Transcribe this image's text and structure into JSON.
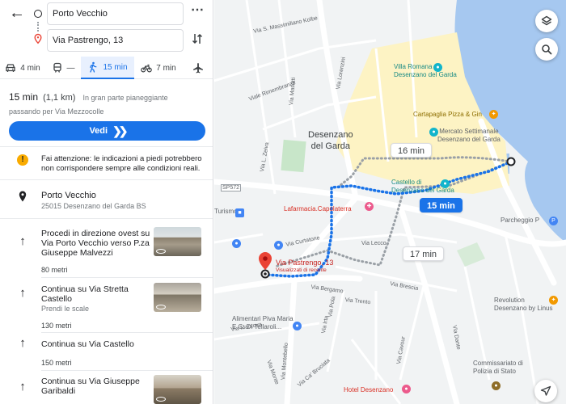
{
  "directions": {
    "origin_value": "Porto Vecchio",
    "destination_value": "Via Pastrengo, 13"
  },
  "modes": [
    {
      "icon": "car-icon",
      "label": "4 min"
    },
    {
      "icon": "transit-icon",
      "label": "—"
    },
    {
      "icon": "walk-icon",
      "label": "15 min",
      "active": true
    },
    {
      "icon": "bike-icon",
      "label": "7 min"
    },
    {
      "icon": "flight-icon",
      "label": ""
    }
  ],
  "summary": {
    "time": "15 min",
    "distance": "(1,1 km)",
    "terrain": "In gran parte pianeggiante",
    "via": "passando per Via Mezzocolle",
    "go_label": "Vedi"
  },
  "warning": "Fai attenzione: le indicazioni a piedi potrebbero non corrispondere sempre alle condizioni reali.",
  "start": {
    "name": "Porto Vecchio",
    "address": "25015 Desenzano del Garda BS"
  },
  "steps": [
    {
      "text": "Procedi in direzione ovest su Via Porto Vecchio verso P.za Giuseppe Malvezzi",
      "distance": "80 metri"
    },
    {
      "text": "Continua su Via Stretta Castello",
      "sub": "Prendi le scale",
      "distance": "130 metri"
    },
    {
      "text": "Continua su Via Castello",
      "distance": "150 metri"
    },
    {
      "text": "Continua su Via Giuseppe Garibaldi"
    }
  ],
  "map": {
    "town": "Desenzano\ndel Garda",
    "route_times": {
      "primary": "15 min",
      "alt1": "16 min",
      "alt2": "17 min"
    },
    "destination_label": "Via Pastrengo, 13",
    "destination_sub": "Visualizzati di recente",
    "places": {
      "villa": "Villa Romana di\nDesenzano del Garda",
      "cartapaglia": "Cartapaglia Pizza & Gin",
      "mercato": "Mercato Settimanale\nDesenzano del Garda",
      "castello": "Castello di\nDesenzano del Garda",
      "farmacia": "Lafarmacia.Capolaterra",
      "parcheggio": "Parcheggio P",
      "revolution": "Revolution\nDesenzano by Linus",
      "alimentari": "Alimentari Piva Maria\nE C. Di Tellaroli...",
      "hotel": "Hotel Desenzano",
      "commissariato": "Commissariato di\nPolizia di Stato",
      "turismo": "Turismo"
    },
    "roads": {
      "r1": "Viale Rimembranze",
      "r2": "Via S. Massimiliano Kolbe",
      "r3": "Via Lorenzini",
      "r4": "Via Masotti",
      "r5": "Via L. Zeiva",
      "r6": "Via Curtatone",
      "r7": "Via Lecco",
      "r8": "Via Brescia",
      "r9": "Via Bergamo",
      "r10": "Via Trento",
      "r11": "Via Pola",
      "r12": "Via Irta",
      "r13": "Via Cavour",
      "r14": "Via Montebello",
      "r15": "Via Mantova",
      "r16": "Via Ca' Bruciata",
      "r17": "Via Monte",
      "r18": "SP572",
      "r19": "Via Dante"
    }
  },
  "colors": {
    "accent": "#1a73e8",
    "water": "#a6c8f0",
    "park": "#c8e6c9",
    "warning": "#f9ab00",
    "pin": "#ea4335"
  }
}
